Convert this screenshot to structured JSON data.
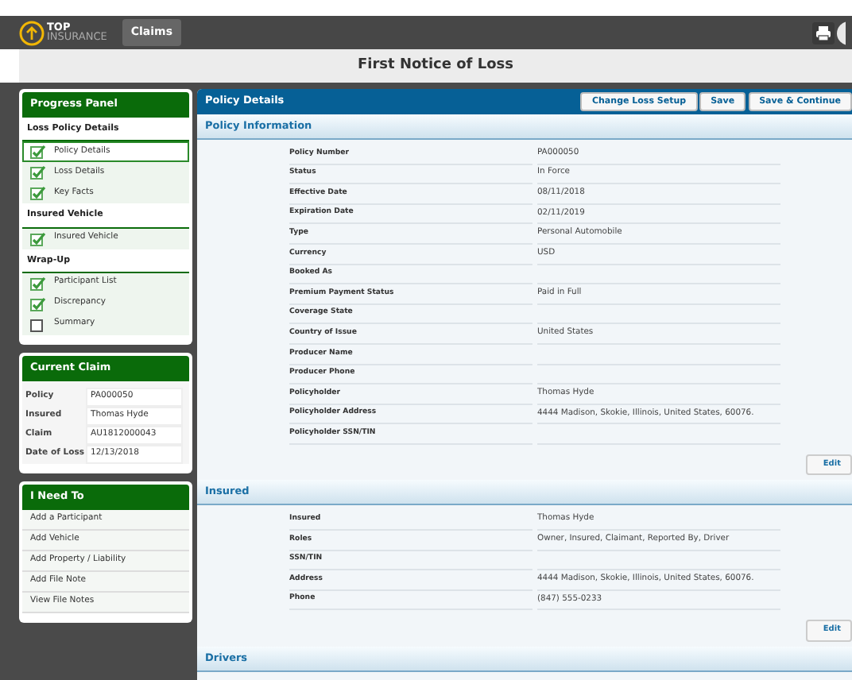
{
  "header": {
    "logo_top": "TOP",
    "logo_bottom": "INSURANCE",
    "nav": "Claims"
  },
  "page_title": "First Notice of Loss",
  "progress_panel": {
    "title": "Progress Panel",
    "groups": [
      {
        "title": "Loss Policy Details",
        "items": [
          {
            "label": "Policy Details",
            "checked": true,
            "selected": true
          },
          {
            "label": "Loss Details",
            "checked": true,
            "selected": false
          },
          {
            "label": "Key Facts",
            "checked": true,
            "selected": false
          }
        ]
      },
      {
        "title": "Insured Vehicle",
        "items": [
          {
            "label": "Insured Vehicle",
            "checked": true,
            "selected": false
          }
        ]
      },
      {
        "title": "Wrap-Up",
        "items": [
          {
            "label": "Participant List",
            "checked": true,
            "selected": false
          },
          {
            "label": "Discrepancy",
            "checked": true,
            "selected": false
          },
          {
            "label": "Summary",
            "checked": false,
            "selected": false
          }
        ]
      }
    ]
  },
  "current_claim": {
    "title": "Current Claim",
    "fields": [
      {
        "label": "Policy",
        "value": "PA000050"
      },
      {
        "label": "Insured",
        "value": "Thomas Hyde"
      },
      {
        "label": "Claim",
        "value": "AU1812000043"
      },
      {
        "label": "Date of Loss",
        "value": "12/13/2018"
      }
    ]
  },
  "i_need_to": {
    "title": "I Need To",
    "links": [
      "Add a Participant",
      "Add Vehicle",
      "Add Property / Liability",
      "Add File Note",
      "View File Notes"
    ]
  },
  "main": {
    "title": "Policy Details",
    "buttons": [
      "Change Loss Setup",
      "Save",
      "Save & Continue"
    ],
    "sections": [
      {
        "title": "Policy Information",
        "edit": "Edit",
        "fields": [
          {
            "label": "Policy Number",
            "value": "PA000050"
          },
          {
            "label": "Status",
            "value": "In Force"
          },
          {
            "label": "Effective Date",
            "value": "08/11/2018"
          },
          {
            "label": "Expiration Date",
            "value": "02/11/2019"
          },
          {
            "label": "Type",
            "value": "Personal Automobile"
          },
          {
            "label": "Currency",
            "value": "USD"
          },
          {
            "label": "Booked As"
          },
          {
            "label": "Premium Payment Status",
            "value": "Paid in Full"
          },
          {
            "label": "Coverage State"
          },
          {
            "label": "Country of Issue",
            "value": "United States"
          },
          {
            "label": "Producer Name"
          },
          {
            "label": "Producer Phone"
          },
          {
            "label": "Policyholder",
            "value": "Thomas Hyde"
          },
          {
            "label": "Policyholder Address",
            "value": "4444 Madison, Skokie, Illinois, United States, 60076."
          },
          {
            "label": "Policyholder SSN/TIN"
          }
        ]
      },
      {
        "title": "Insured",
        "edit": "Edit",
        "fields": [
          {
            "label": "Insured",
            "value": "Thomas Hyde"
          },
          {
            "label": "Roles",
            "value": "Owner, Insured, Claimant, Reported By, Driver"
          },
          {
            "label": "SSN/TIN"
          },
          {
            "label": "Address",
            "value": "4444 Madison, Skokie, Illinois, United States, 60076."
          },
          {
            "label": "Phone",
            "value": "(847) 555-0233"
          }
        ]
      },
      {
        "title": "Drivers"
      }
    ]
  }
}
